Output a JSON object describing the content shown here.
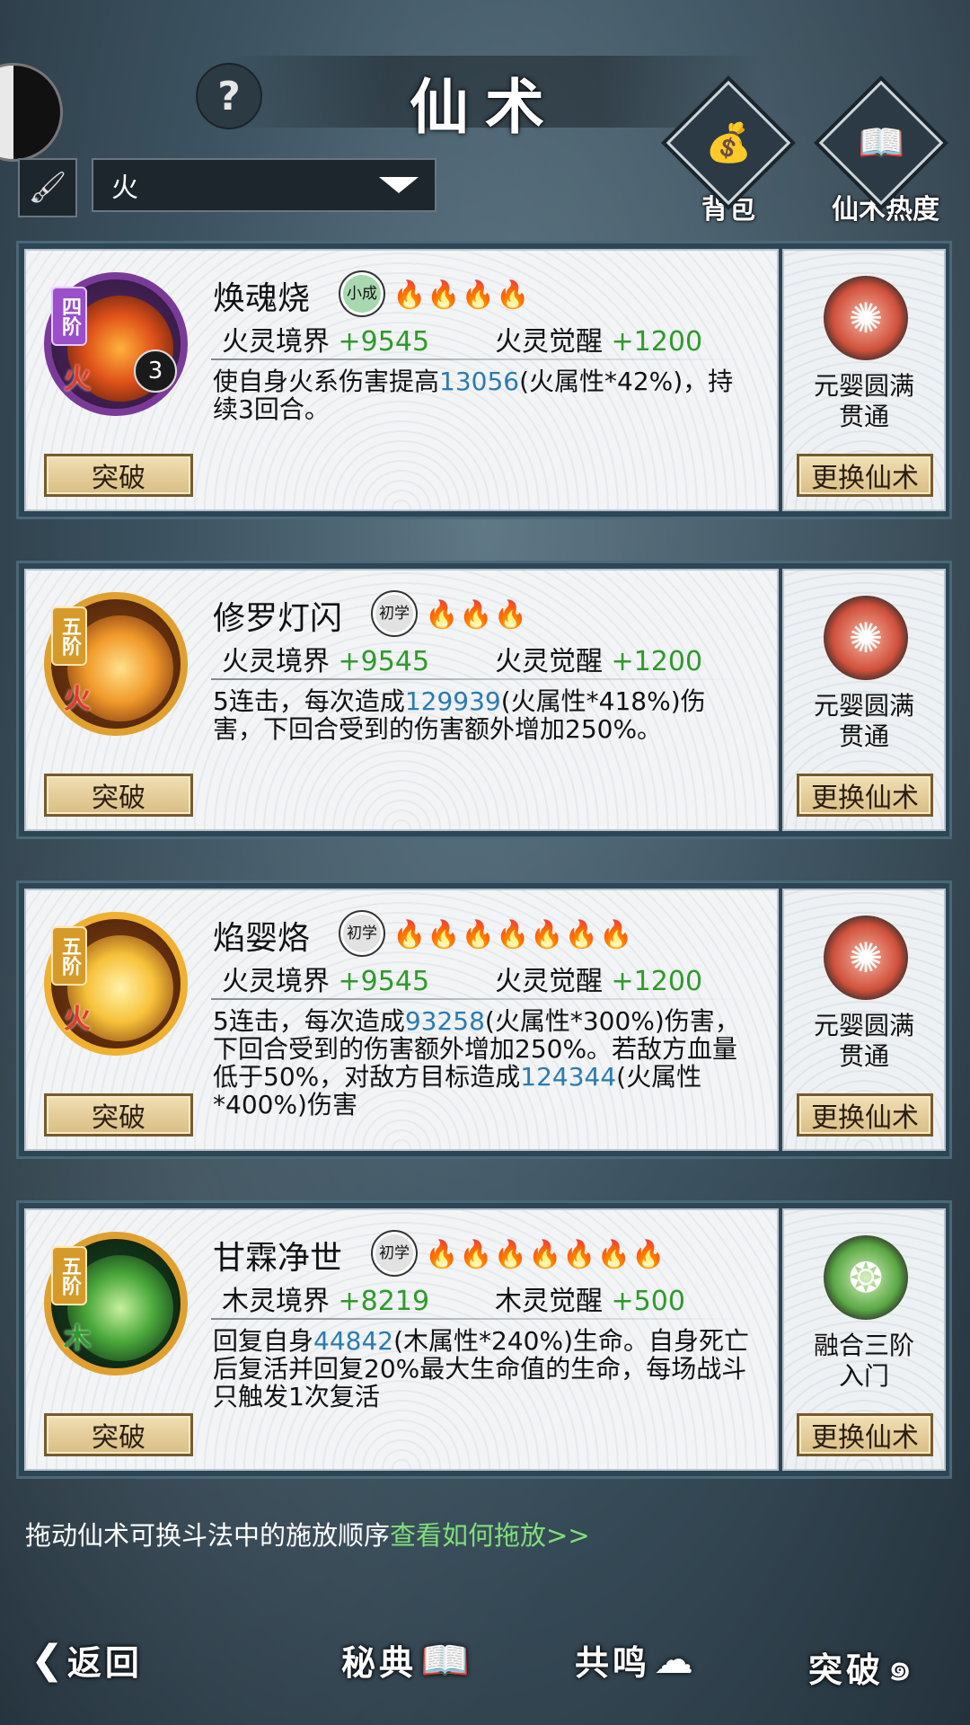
{
  "header": {
    "title": "仙术",
    "help": "?",
    "filter_value": "火",
    "brush_icon": "brush-icon",
    "bag_label": "背包",
    "heat_label": "仙术热度"
  },
  "cards": [
    {
      "tier": "四阶",
      "element": "火",
      "badge": "3",
      "name": "焕魂烧",
      "rank": "小成",
      "flames_on": "🔥🔥🔥",
      "flames_off": "🔥",
      "realm_label": "火灵境界",
      "realm_val": "+9545",
      "awake_label": "火灵觉醒",
      "awake_val": "+1200",
      "desc_a": "使自身火系伤害提高",
      "desc_n1": "13056",
      "desc_b": "(火属性*42%)，持续3回合。",
      "desc_n2": "",
      "desc_c": "",
      "break_label": "突破",
      "side_line1": "元婴圆满",
      "side_line2": "贯通",
      "swap_label": "更换仙术"
    },
    {
      "tier": "五阶",
      "element": "火",
      "badge": "",
      "name": "修罗灯闪",
      "rank": "初学",
      "flames_on": "",
      "flames_off": "🔥🔥🔥",
      "realm_label": "火灵境界",
      "realm_val": "+9545",
      "awake_label": "火灵觉醒",
      "awake_val": "+1200",
      "desc_a": "5连击，每次造成",
      "desc_n1": "129939",
      "desc_b": "(火属性*418%)伤害，下回合受到的伤害额外增加250%。",
      "desc_n2": "",
      "desc_c": "",
      "break_label": "突破",
      "side_line1": "元婴圆满",
      "side_line2": "贯通",
      "swap_label": "更换仙术"
    },
    {
      "tier": "五阶",
      "element": "火",
      "badge": "",
      "name": "焰婴烙",
      "rank": "初学",
      "flames_on": "",
      "flames_off": "🔥🔥🔥🔥🔥🔥🔥",
      "realm_label": "火灵境界",
      "realm_val": "+9545",
      "awake_label": "火灵觉醒",
      "awake_val": "+1200",
      "desc_a": "5连击，每次造成",
      "desc_n1": "93258",
      "desc_b": "(火属性*300%)伤害，下回合受到的伤害额外增加250%。若敌方血量低于50%，对敌方目标造成",
      "desc_n2": "124344",
      "desc_c": "(火属性*400%)伤害",
      "break_label": "突破",
      "side_line1": "元婴圆满",
      "side_line2": "贯通",
      "swap_label": "更换仙术"
    },
    {
      "tier": "五阶",
      "element": "木",
      "badge": "",
      "name": "甘霖净世",
      "rank": "初学",
      "flames_on": "",
      "flames_off": "🔥🔥🔥🔥🔥🔥🔥",
      "realm_label": "木灵境界",
      "realm_val": "+8219",
      "awake_label": "木灵觉醒",
      "awake_val": "+500",
      "desc_a": "回复自身",
      "desc_n1": "44842",
      "desc_b": "(木属性*240%)生命。自身死亡后复活并回复20%最大生命值的生命，每场战斗只触发1次复活",
      "desc_n2": "",
      "desc_c": "",
      "break_label": "突破",
      "side_line1": "融合三阶",
      "side_line2": "入门",
      "swap_label": "更换仙术"
    }
  ],
  "hint": {
    "text": "拖动仙术可换斗法中的施放顺序",
    "link": "查看如何拖放>>"
  },
  "bottom_nav": {
    "back": "返回",
    "secret": "秘典",
    "resonance": "共鸣",
    "breakthrough": "突破"
  },
  "colors": {
    "fire_tier": "#9b4fc8",
    "gold_tier": "#d59a2a",
    "green_value": "#2e9a2a",
    "blue_number": "#2a7bb0",
    "link_green": "#7ee07a"
  }
}
